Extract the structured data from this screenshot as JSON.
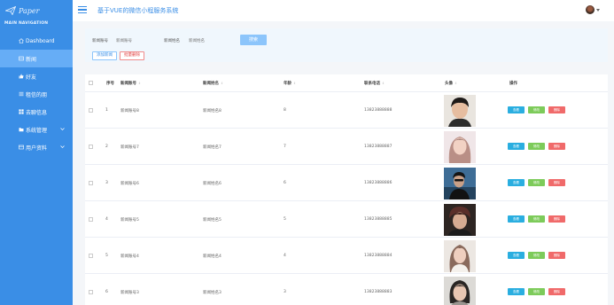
{
  "sidebar": {
    "brand": "Paper",
    "nav_title": "MAIN NAVIGATION",
    "items": [
      {
        "label": "Dashboard",
        "icon": "home-icon",
        "active": false,
        "has_children": false
      },
      {
        "label": "新闻",
        "icon": "grid-icon",
        "active": true,
        "has_children": false
      },
      {
        "label": "好友",
        "icon": "thumbs-up-icon",
        "active": false,
        "has_children": false
      },
      {
        "label": "租信的朋",
        "icon": "list-icon",
        "active": false,
        "has_children": false
      },
      {
        "label": "去聊信息",
        "icon": "apps-icon",
        "active": false,
        "has_children": false
      },
      {
        "label": "系统管理",
        "icon": "folder-icon",
        "active": false,
        "has_children": true
      },
      {
        "label": "用户资料",
        "icon": "card-icon",
        "active": false,
        "has_children": true
      }
    ]
  },
  "header": {
    "title": "基于VUE的微信小程服务系统"
  },
  "search": {
    "account_label": "新闻账号",
    "account_placeholder": "新闻账号",
    "name_label": "新闻姓名",
    "name_placeholder": "新闻姓名",
    "search_button": "搜索",
    "add_button": "添加新闻",
    "batch_delete_button": "批量删除"
  },
  "table": {
    "columns": [
      "序号",
      "新闻账号",
      "新闻姓名",
      "年龄",
      "联系电话",
      "头像",
      "操作"
    ],
    "rows": [
      {
        "index": "1",
        "account": "新闻账号8",
        "name": "新闻姓名8",
        "age": "8",
        "phone": "13823888888"
      },
      {
        "index": "2",
        "account": "新闻账号7",
        "name": "新闻姓名7",
        "age": "7",
        "phone": "13823888887"
      },
      {
        "index": "3",
        "account": "新闻账号6",
        "name": "新闻姓名6",
        "age": "6",
        "phone": "13823888886"
      },
      {
        "index": "4",
        "account": "新闻账号5",
        "name": "新闻姓名5",
        "age": "5",
        "phone": "13823888885"
      },
      {
        "index": "5",
        "account": "新闻账号4",
        "name": "新闻姓名4",
        "age": "4",
        "phone": "13823888884"
      },
      {
        "index": "6",
        "account": "新闻账号3",
        "name": "新闻姓名3",
        "age": "3",
        "phone": "13823888883"
      }
    ],
    "op_view": "查看",
    "op_edit": "修改",
    "op_delete": "删除"
  },
  "colors": {
    "sidebar_bg": "#3a8ee6",
    "sidebar_active": "#66adf6",
    "primary": "#3a8ee6",
    "view_button": "#2aaee0",
    "edit_button": "#7dcb5a",
    "delete_button": "#f06a6a"
  }
}
